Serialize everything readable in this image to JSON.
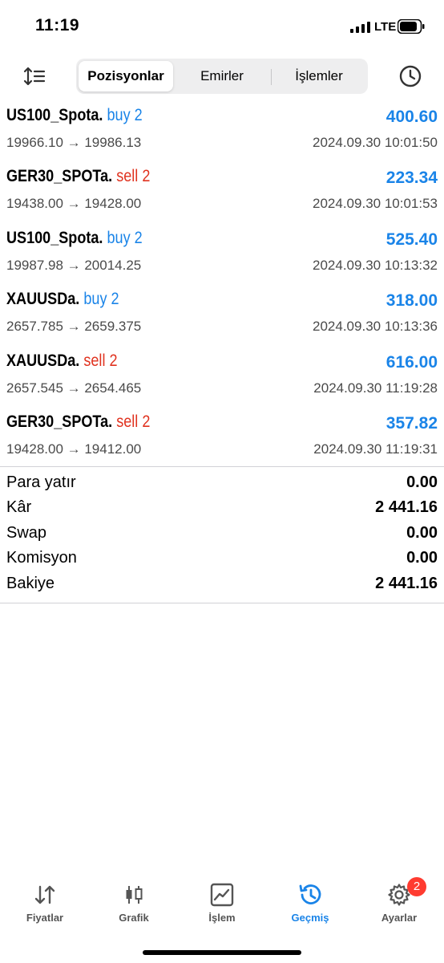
{
  "status": {
    "time": "11:19",
    "network": "LTE"
  },
  "toolbar": {
    "tabs": [
      {
        "label": "Pozisyonlar"
      },
      {
        "label": "Emirler"
      },
      {
        "label": "İşlemler"
      }
    ]
  },
  "deals": [
    {
      "symbol": "US100_Spota.",
      "side": "buy 2",
      "direction": "buy",
      "profit": "400.60",
      "prices": "19966.10 → 19986.13",
      "time": "2024.09.30 10:01:50"
    },
    {
      "symbol": "GER30_SPOTa.",
      "side": "sell 2",
      "direction": "sell",
      "profit": "223.34",
      "prices": "19438.00 → 19428.00",
      "time": "2024.09.30 10:01:53"
    },
    {
      "symbol": "US100_Spota.",
      "side": "buy 2",
      "direction": "buy",
      "profit": "525.40",
      "prices": "19987.98 → 20014.25",
      "time": "2024.09.30 10:13:32"
    },
    {
      "symbol": "XAUUSDa.",
      "side": "buy 2",
      "direction": "buy",
      "profit": "318.00",
      "prices": "2657.785 → 2659.375",
      "time": "2024.09.30 10:13:36"
    },
    {
      "symbol": "XAUUSDa.",
      "side": "sell 2",
      "direction": "sell",
      "profit": "616.00",
      "prices": "2657.545 → 2654.465",
      "time": "2024.09.30 11:19:28"
    },
    {
      "symbol": "GER30_SPOTa.",
      "side": "sell 2",
      "direction": "sell",
      "profit": "357.82",
      "prices": "19428.00 → 19412.00",
      "time": "2024.09.30 11:19:31"
    }
  ],
  "summary": [
    {
      "label": "Para yatır",
      "value": "0.00"
    },
    {
      "label": "Kâr",
      "value": "2 441.16"
    },
    {
      "label": "Swap",
      "value": "0.00"
    },
    {
      "label": "Komisyon",
      "value": "0.00"
    },
    {
      "label": "Bakiye",
      "value": "2 441.16"
    }
  ],
  "tabbar": {
    "items": [
      {
        "label": "Fiyatlar",
        "icon": "quotes-arrows-icon"
      },
      {
        "label": "Grafik",
        "icon": "candlestick-chart-icon"
      },
      {
        "label": "İşlem",
        "icon": "trade-chart-icon"
      },
      {
        "label": "Geçmiş",
        "icon": "history-icon"
      },
      {
        "label": "Ayarlar",
        "icon": "gear-icon"
      }
    ],
    "settings_badge": "2"
  },
  "colors": {
    "accent": "#1a84e8",
    "buy": "#1a84e8",
    "sell": "#e0321f",
    "badge": "#ff3b30"
  }
}
